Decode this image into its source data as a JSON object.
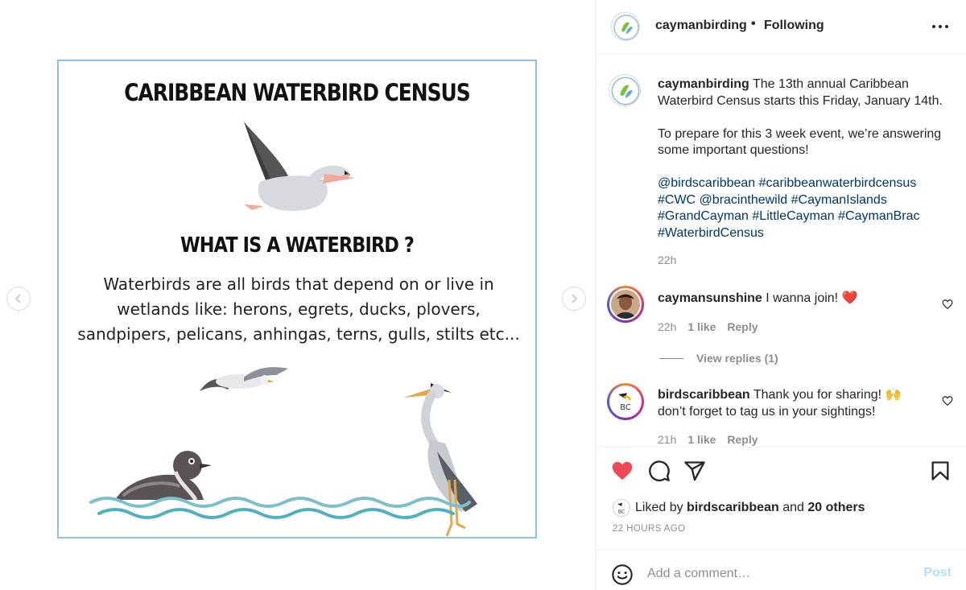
{
  "post_image": {
    "title": "CARIBBEAN WATERBIRD CENSUS",
    "subtitle": "WHAT IS A WATERBIRD ?",
    "body": "Waterbirds are all birds that depend on or live in wetlands like: herons, egrets, ducks, plovers, sandpipers, pelicans, anhingas, terns, gulls, stilts etc..."
  },
  "nav": {
    "prev_icon": "chevron-left-icon",
    "next_icon": "chevron-right-icon"
  },
  "header": {
    "username": "caymanbirding",
    "separator": "•",
    "follow_status": "Following",
    "more_icon": "more-horizontal-icon"
  },
  "caption": {
    "username": "caymanbirding",
    "text_line1": "The 13th annual Caribbean Waterbird Census starts this Friday, January 14th.",
    "text_line2": "To prepare for this 3 week event, we’re answering some important questions!",
    "tags": [
      "@birdscaribbean",
      "#caribbeanwaterbirdcensus",
      "#CWC",
      "@bracinthewild",
      "#CaymanIslands",
      "#GrandCayman",
      "#LittleCayman",
      "#CaymanBrac",
      "#WaterbirdCensus"
    ],
    "time": "22h"
  },
  "comments": [
    {
      "username": "caymansunshine",
      "text": "I wanna join! ❤️",
      "time": "22h",
      "likes": "1 like",
      "reply_label": "Reply",
      "view_replies": "View replies (1)"
    },
    {
      "username": "birdscaribbean",
      "text": "Thank you for sharing! 🙌 don’t forget to tag us in your sightings!",
      "time": "21h",
      "likes": "1 like",
      "reply_label": "Reply"
    }
  ],
  "actions": {
    "like_icon": "heart-filled-icon",
    "comment_icon": "comment-icon",
    "share_icon": "paper-plane-icon",
    "save_icon": "bookmark-icon",
    "like_color": "#ed4956"
  },
  "likes": {
    "prefix": "Liked by",
    "user": "birdscaribbean",
    "and": "and",
    "others": "20 others"
  },
  "timestamp": "22 HOURS AGO",
  "add_comment": {
    "placeholder": "Add a comment…",
    "post_label": "Post",
    "emoji_icon": "smiley-icon"
  }
}
